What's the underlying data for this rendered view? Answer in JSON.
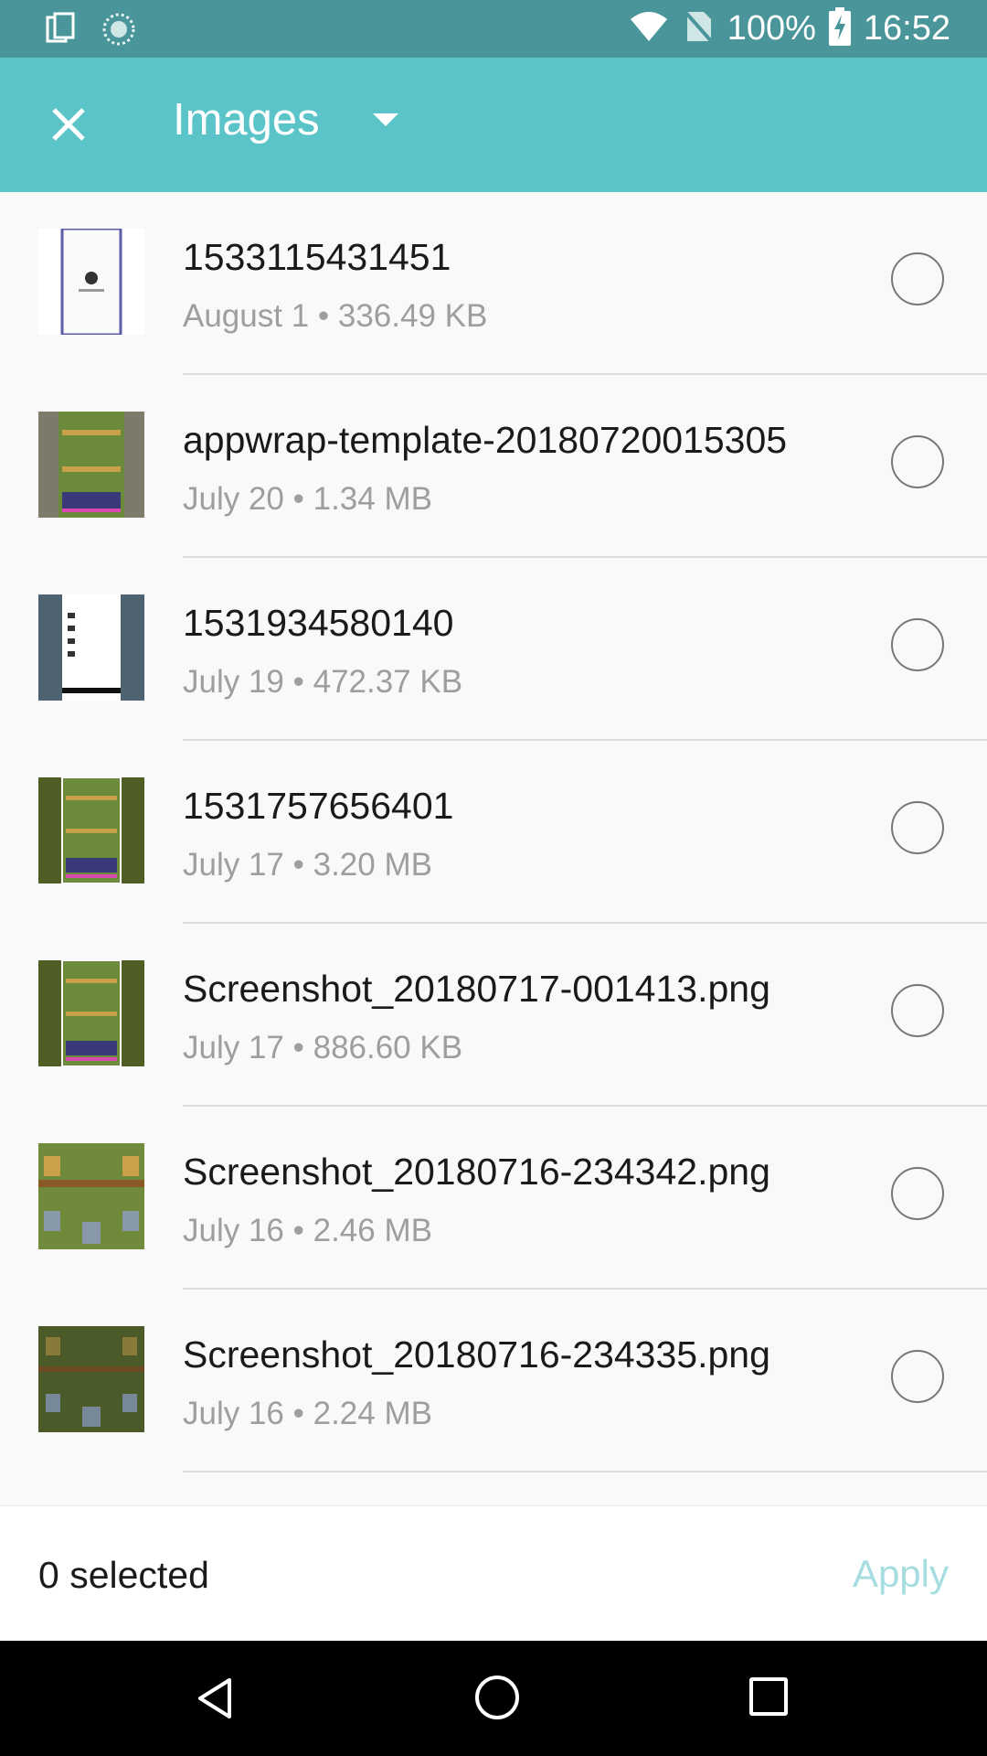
{
  "status_bar": {
    "battery": "100%",
    "time": "16:52",
    "icons": [
      "copy-icon",
      "sync-icon",
      "wifi-icon",
      "no-sim-icon",
      "battery-charging-icon"
    ]
  },
  "toolbar": {
    "close_icon": "close-icon",
    "title": "Images",
    "dropdown_icon": "dropdown-arrow-icon",
    "color": "#5bc4c9"
  },
  "files": [
    {
      "name": "1533115431451",
      "meta": "August 1 • 336.49 KB",
      "selected": false
    },
    {
      "name": "appwrap-template-20180720015305",
      "meta": "July 20 • 1.34 MB",
      "selected": false
    },
    {
      "name": "1531934580140",
      "meta": "July 19 • 472.37 KB",
      "selected": false
    },
    {
      "name": "1531757656401",
      "meta": "July 17 • 3.20 MB",
      "selected": false
    },
    {
      "name": "Screenshot_20180717-001413.png",
      "meta": "July 17 • 886.60 KB",
      "selected": false
    },
    {
      "name": "Screenshot_20180716-234342.png",
      "meta": "July 16 • 2.46 MB",
      "selected": false
    },
    {
      "name": "Screenshot_20180716-234335.png",
      "meta": "July 16 • 2.24 MB",
      "selected": false
    }
  ],
  "footer": {
    "selected_count": "0 selected",
    "apply_label": "Apply"
  },
  "nav_bar": {
    "icons": [
      "back-icon",
      "home-icon",
      "recents-icon"
    ]
  }
}
